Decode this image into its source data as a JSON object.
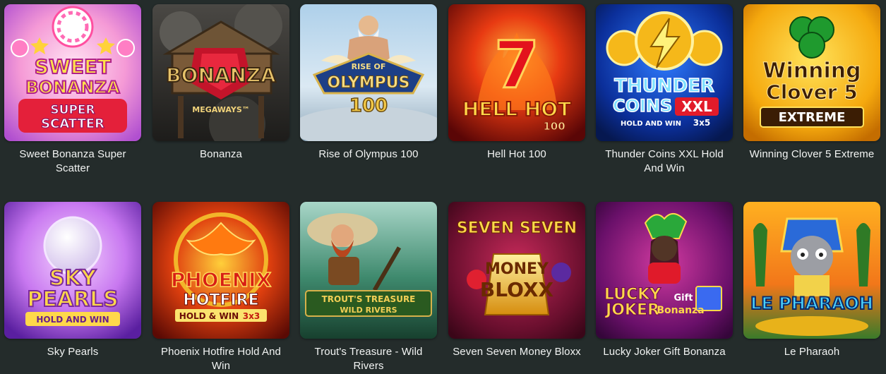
{
  "games": [
    {
      "title": "Sweet Bonanza Super Scatter",
      "logo_lines": [
        "SWEET",
        "BONANZA",
        "SUPER",
        "SCATTER"
      ]
    },
    {
      "title": "Bonanza",
      "logo_lines": [
        "BONANZA",
        "MEGAWAYS™"
      ]
    },
    {
      "title": "Rise of Olympus 100",
      "logo_lines": [
        "RISE OF",
        "OLYMPUS",
        "100"
      ]
    },
    {
      "title": "Hell Hot 100",
      "logo_lines": [
        "7",
        "HELL HOT",
        "100"
      ]
    },
    {
      "title": "Thunder Coins XXL Hold And Win",
      "logo_lines": [
        "THUNDER",
        "COINS",
        "XXL",
        "HOLD AND WIN",
        "3x5"
      ]
    },
    {
      "title": "Winning Clover 5 Extreme",
      "logo_lines": [
        "Winning",
        "Clover 5",
        "EXTREME"
      ]
    },
    {
      "title": "Sky Pearls",
      "logo_lines": [
        "SKY",
        "PEARLS",
        "HOLD AND WIN"
      ]
    },
    {
      "title": "Phoenix Hotfire Hold And Win",
      "logo_lines": [
        "PHOENIX",
        "HOTFIRE",
        "HOLD & WIN",
        "3x3"
      ]
    },
    {
      "title": "Trout's Treasure - Wild Rivers",
      "logo_lines": [
        "TROUT'S TREASURE",
        "WILD RIVERS"
      ]
    },
    {
      "title": "Seven Seven Money Bloxx",
      "logo_lines": [
        "SEVEN SEVEN",
        "MONEY",
        "BLOXX"
      ]
    },
    {
      "title": "Lucky Joker Gift Bonanza",
      "logo_lines": [
        "LUCKY",
        "JOKER",
        "Gift",
        "Bonanza"
      ]
    },
    {
      "title": "Le Pharaoh",
      "logo_lines": [
        "LE PHARAOH"
      ]
    }
  ]
}
